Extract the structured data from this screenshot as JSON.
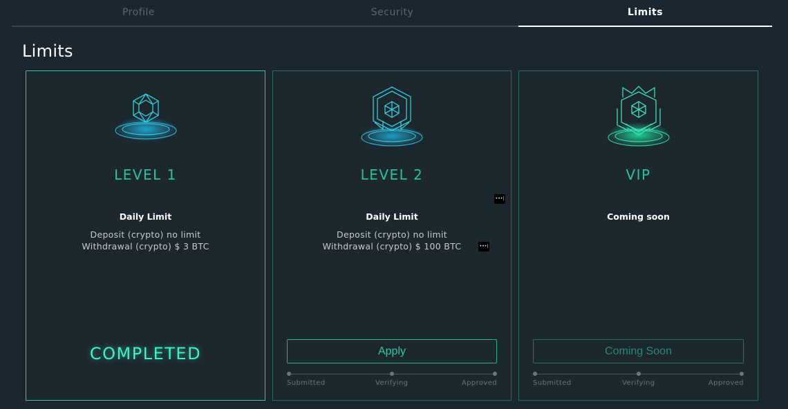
{
  "tabs": [
    {
      "label": "Profile",
      "active": false
    },
    {
      "label": "Security",
      "active": false
    },
    {
      "label": "Limits",
      "active": true
    }
  ],
  "page_title": "Limits",
  "cards": [
    {
      "level": "LEVEL 1",
      "subtitle": "Daily Limit",
      "line1": "Deposit (crypto) no limit",
      "line2": "Withdrawal (crypto) $ 3 BTC",
      "status": "COMPLETED",
      "icon": "level-1-hexagon-icon"
    },
    {
      "level": "LEVEL 2",
      "subtitle": "Daily Limit",
      "line1": "Deposit (crypto) no limit",
      "line2": "Withdrawal (crypto) $ 100 BTC",
      "button": "Apply",
      "steps": [
        "Submitted",
        "Verifying",
        "Approved"
      ],
      "icon": "level-2-shield-icon"
    },
    {
      "level": "VIP",
      "subtitle": "Coming soon",
      "button": "Coming Soon",
      "steps": [
        "Submitted",
        "Verifying",
        "Approved"
      ],
      "icon": "vip-crown-icon"
    }
  ],
  "more_glyph": "•••|",
  "colors": {
    "background": "#1c262e",
    "accent": "#29c2a1",
    "completed": "#3ff0c8",
    "card_border": "#2a6a63"
  }
}
